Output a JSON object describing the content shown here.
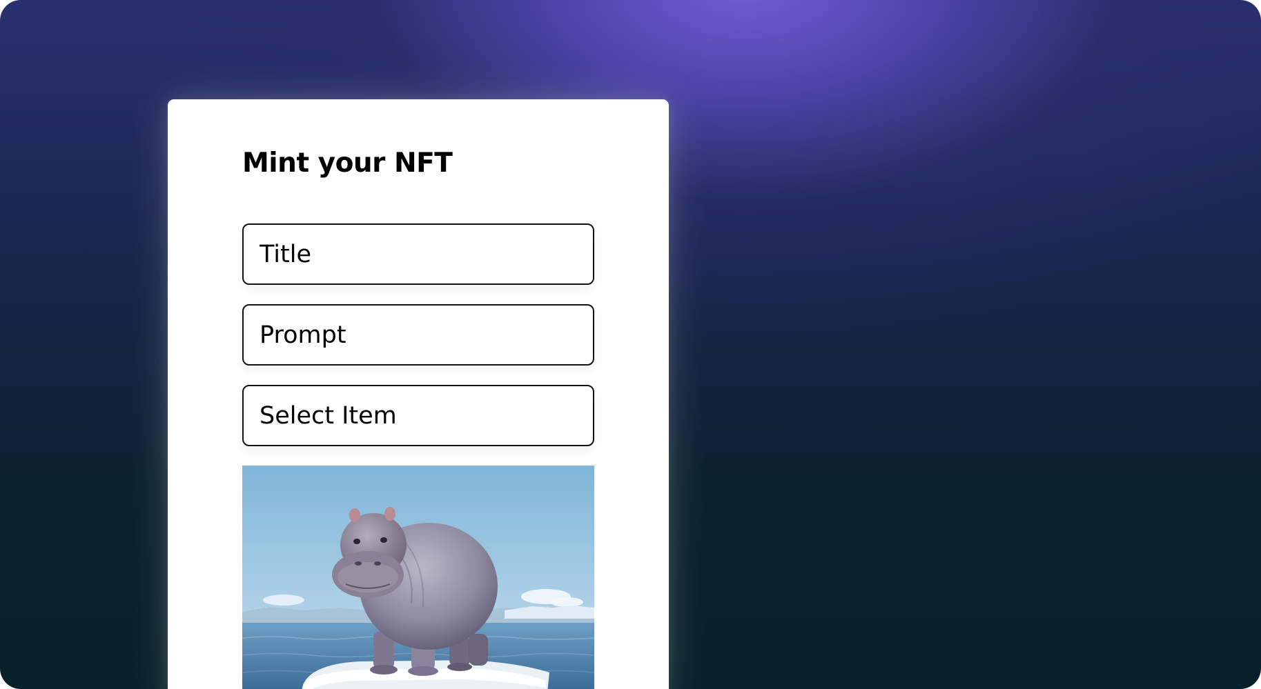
{
  "form": {
    "heading": "Mint your NFT",
    "title_placeholder": "Title",
    "prompt_placeholder": "Prompt",
    "select_label": "Select Item"
  },
  "colors": {
    "accent_glow": "#6a5ad2",
    "background_dark": "#07202a",
    "card": "#ffffff",
    "field_border": "#111111"
  },
  "image": {
    "icon": "hippo-on-ice-image"
  }
}
